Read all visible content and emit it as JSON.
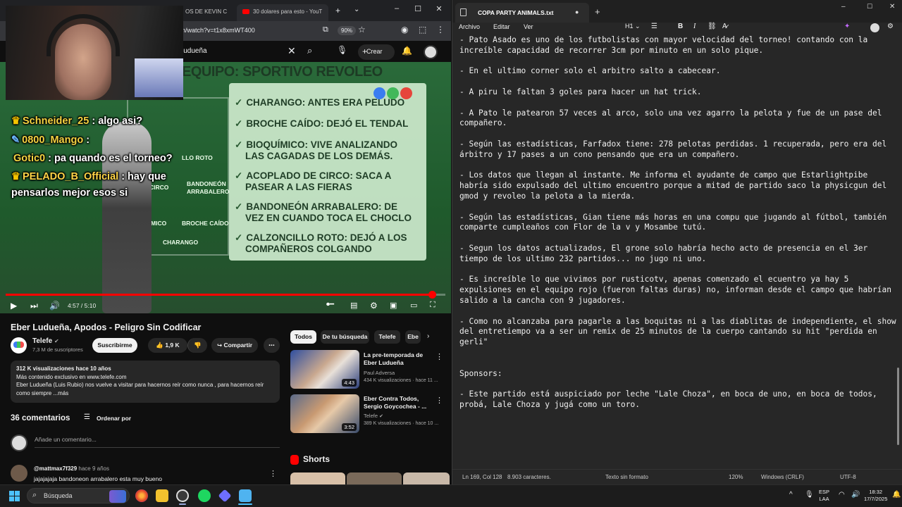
{
  "browser": {
    "tabs": [
      "OS DE KEVIN C",
      "30 dolares para esto - YouT"
    ],
    "url": "n/watch?v=t1x8xmWT400",
    "zoom": "90%",
    "search_query": "ludueña",
    "create_label": "Crear"
  },
  "video": {
    "board_title": "EQUIPO: SPORTIVO REVOLEO",
    "board_items": [
      "CHARANGO: ANTES ERA PELUDO",
      "BROCHE CAÍDO: DEJÓ EL TENDAL",
      "BIOQUÍMICO: VIVE ANALIZANDO",
      "LAS CAGADAS DE LOS DEMÁS.",
      "ACOPLADO DE CIRCO: SACA A",
      "PASEAR A LAS FIERAS",
      "BANDONEÓN ARRABALERO: DE",
      "VEZ EN CUANDO TOCA EL CHOCLO",
      "CALZONCILLO ROTO: DEJÓ A LOS",
      "COMPAÑEROS COLGANDO"
    ],
    "field_labels": [
      "LLO ROTO",
      "BANDONEÓN",
      "ARRABALERO",
      "CIRCO",
      "MICO",
      "BROCHE CAÍDO",
      "CHARANGO"
    ],
    "time": "4:57 / 5:10",
    "progress": 0.97
  },
  "chat": [
    {
      "user": "Schneider_25",
      "msg": ": algo asi?"
    },
    {
      "user": "0800_Mango",
      "msg": ":"
    },
    {
      "user": "Gotic0",
      "msg": ": pa quando es el torneo?"
    },
    {
      "user": "PELADO_B_Official",
      "msg": ": hay que"
    },
    {
      "user": "",
      "msg": "pensarlos mejor esos si"
    }
  ],
  "watch": {
    "title": "Eber Ludueña, Apodos - Peligro Sin Codificar",
    "channel": "Telefe",
    "subs": "7,3 M de suscriptores",
    "subscribe": "Suscribirme",
    "likes": "1,9 K",
    "share": "Compartir",
    "desc_stats": "312 K visualizaciones  hace 10 años",
    "desc_line1": "Más contenido exclusivo en www.telefe.com",
    "desc_line2": "Eber Ludueña (Luis Rubio) nos vuelve a visitar para hacernos reír como nunca , para hacernos reír",
    "desc_line3": "como siempre ...más",
    "comments_count": "36 comentarios",
    "sort_label": "Ordenar por",
    "add_comment": "Añade un comentario...",
    "comment1_user": "@mattmax7f329",
    "comment1_time": "hace 9 años",
    "comment1_text": "jajajajaja  bandoneon arrabalero  esta muy bueno"
  },
  "recommend": {
    "chips": [
      "Todos",
      "De tu búsqueda",
      "Telefe",
      "Ebe"
    ],
    "items": [
      {
        "title": "La pre-temporada de Eber Ludueña",
        "channel": "Paul Adversa",
        "stats": "434 K visualizaciones · hace 11 ...",
        "duration": "4:43"
      },
      {
        "title": "Eber Contra Todos, Sergio Goycochea - ...",
        "channel": "Telefe",
        "stats": "389 K visualizaciones · hace 10 ...",
        "duration": "3:52"
      }
    ],
    "shorts": "Shorts"
  },
  "notepad": {
    "tab_title": "COPA PARTY ANIMALS.txt",
    "menus": [
      "Archivo",
      "Editar",
      "Ver"
    ],
    "heading_tool": "H1",
    "text": "- Pato Asado es uno de los futbolistas con mayor velocidad del torneo! contando con la\nincreíble capacidad de recorrer 3cm por minuto en un solo pique.\n\n- En el ultimo corner solo el arbitro salto a cabecear.\n\n- A piru le faltan 3 goles para hacer un hat trick.\n\n- A Pato le patearon 57 veces al arco, solo una vez agarro la pelota y fue de un pase del\ncompañero.\n\n- Según las estadísticas, Farfadox tiene: 278 pelotas perdidas. 1 recuperada, pero era del\nárbitro y 17 pases a un cono pensando que era un compañero.\n\n- Los datos que llegan al instante. Me informa el ayudante de campo que Estarlightpibe\nhabría sido expulsado del ultimo encuentro porque a mitad de partido saco la physicgun del\ngmod y revoleo la pelota a la mierda.\n\n- Según las estadísticas, Gian tiene más horas en una compu que jugando al fútbol, también\ncomparte cumpleaños con Flor de la v y Mosambe tutú.\n\n- Segun los datos actualizados, El grone solo habría hecho acto de presencia en el 3er\ntiempo de los ultimo 232 partidos... no jugo ni uno.\n\n- Es increíble lo que vivimos por rusticotv, apenas comenzado el ecuentro ya hay 5\nexpulsiones en el equipo rojo (fueron faltas duras) no, informan desde el campo que habrían\nsalido a la cancha con 9 jugadores.\n\n- Como no alcanzaba para pagarle a las boquitas ni a las diablitas de independiente, el show\ndel entretiempo va a ser un remix de 25 minutos de la cuerpo cantando su hit \"perdida en\ngerli\"\n\n\nSponsors:\n\n- Este partido está auspiciado por leche \"Lale Choza\", en boca de uno, en boca de todos,\nprobá, Lale Choza y jugá como un toro.",
    "status_pos": "Ln 169, Col 128",
    "status_chars": "8.903 caracteres.",
    "status_format": "Texto sin formato",
    "status_zoom": "120%",
    "status_eol": "Windows (CRLF)",
    "status_enc": "UTF-8"
  },
  "taskbar": {
    "search": "Búsqueda",
    "lang1": "ESP",
    "lang2": "LAA",
    "time": "18:32",
    "date": "17/7/2025"
  }
}
